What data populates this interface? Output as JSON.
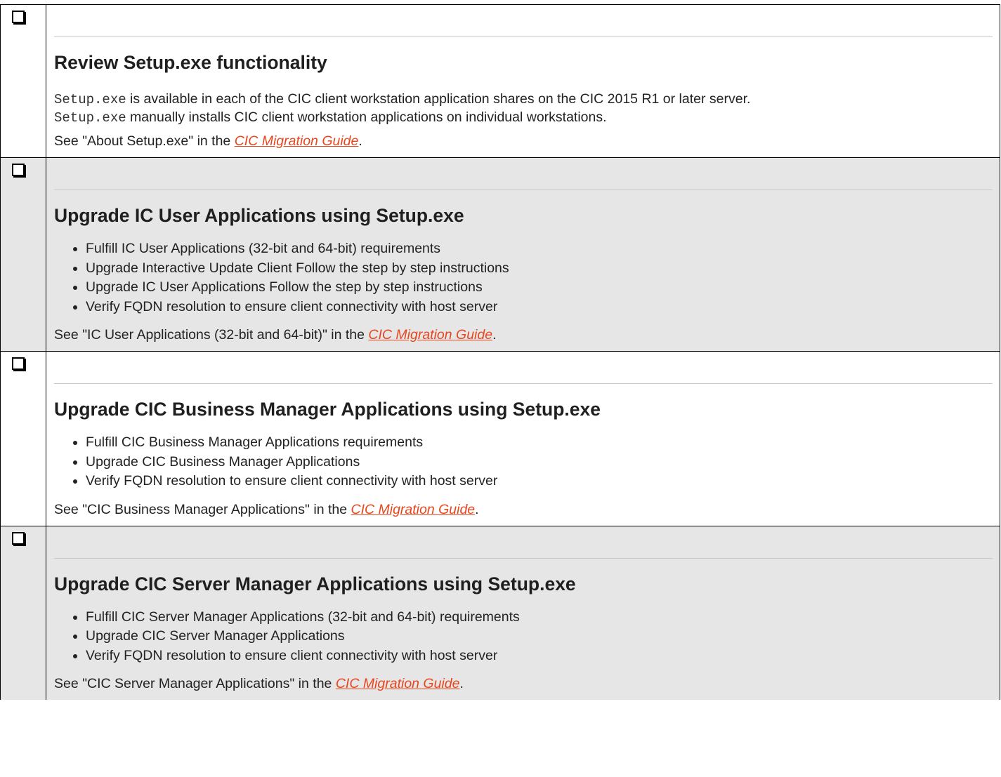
{
  "rows": [
    {
      "title": "Review Setup.exe functionality",
      "desc_lines": [
        {
          "code": "Setup.exe",
          "text": " is available in each of the CIC client workstation application shares on the CIC 2015 R1 or later server."
        },
        {
          "code": "Setup.exe",
          "text": " manually installs CIC client workstation applications on individual workstations."
        }
      ],
      "see_prefix": "See \"About Setup.exe\" in the ",
      "link": "CIC Migration Guide",
      "see_suffix": "."
    },
    {
      "title": "Upgrade IC User Applications using Setup.exe",
      "items": [
        "Fulfill IC User Applications (32-bit and 64-bit) requirements",
        "Upgrade Interactive Update Client Follow the step by step instructions",
        "Upgrade IC User Applications Follow the step by step instructions",
        "Verify FQDN resolution to ensure client connectivity with host server"
      ],
      "see_prefix": "See \"IC User Applications (32-bit and 64-bit)\" in the ",
      "link": "CIC Migration Guide",
      "see_suffix": "."
    },
    {
      "title": "Upgrade CIC Business Manager Applications using Setup.exe",
      "items": [
        "Fulfill CIC Business Manager Applications requirements",
        "Upgrade CIC Business Manager Applications",
        "Verify FQDN resolution to ensure client connectivity with host server"
      ],
      "see_prefix": "See \"CIC Business Manager Applications\" in the ",
      "link": "CIC Migration Guide",
      "see_suffix": "."
    },
    {
      "title": "Upgrade CIC Server Manager Applications using Setup.exe",
      "items": [
        "Fulfill CIC Server Manager Applications (32-bit and 64-bit) requirements",
        "Upgrade CIC Server Manager Applications",
        "Verify FQDN resolution to ensure client connectivity with host server"
      ],
      "see_prefix": "See \"CIC Server Manager Applications\" in the ",
      "link": "CIC Migration Guide",
      "see_suffix": "."
    }
  ]
}
